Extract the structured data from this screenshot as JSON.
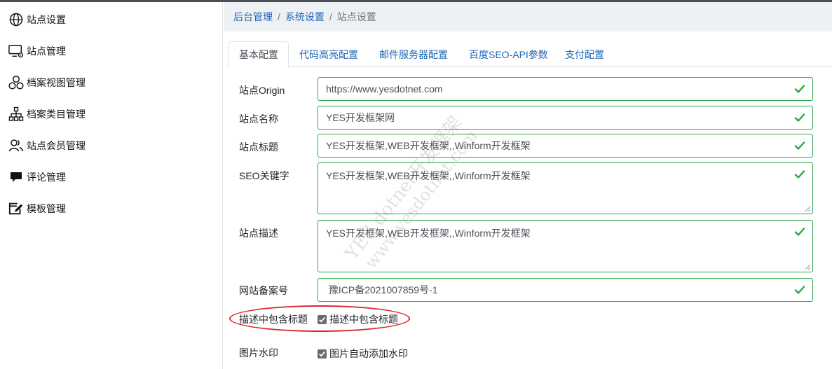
{
  "sidebar": {
    "items": [
      {
        "label": "站点设置",
        "icon": "globe-icon"
      },
      {
        "label": "站点管理",
        "icon": "monitor-gear-icon"
      },
      {
        "label": "档案视图管理",
        "icon": "circles-icon"
      },
      {
        "label": "档案类目管理",
        "icon": "sitemap-icon"
      },
      {
        "label": "站点会员管理",
        "icon": "users-icon"
      },
      {
        "label": "评论管理",
        "icon": "comment-icon"
      },
      {
        "label": "模板管理",
        "icon": "template-edit-icon"
      }
    ]
  },
  "breadcrumb": {
    "items": [
      "后台管理",
      "系统设置"
    ],
    "separator": "/",
    "current": "站点设置"
  },
  "tabs": [
    {
      "label": "基本配置",
      "active": true
    },
    {
      "label": "代码高亮配置"
    },
    {
      "label": "邮件服务器配置"
    },
    {
      "label": "百度SEO-API参数"
    },
    {
      "label": "支付配置"
    }
  ],
  "form": {
    "origin": {
      "label": "站点Origin",
      "value": "https://www.yesdotnet.com"
    },
    "name": {
      "label": "站点名称",
      "value": "YES开发框架网"
    },
    "title": {
      "label": "站点标题",
      "value": "YES开发框架,WEB开发框架,,Winform开发框架"
    },
    "keywords": {
      "label": "SEO关键字",
      "value": "YES开发框架,WEB开发框架,,Winform开发框架"
    },
    "description": {
      "label": "站点描述",
      "value": "YES开发框架,WEB开发框架,,Winform开发框架"
    },
    "icp": {
      "label": "网站备案号",
      "value": " 豫ICP备2021007859号-1"
    },
    "desc_include_title": {
      "label": "描述中包含标题",
      "checkbox_label": "描述中包含标题",
      "checked": true
    },
    "watermark": {
      "label": "图片水印",
      "checkbox_label": "图片自动添加水印",
      "checked": true
    }
  },
  "watermark_text": {
    "line1": "YES dotnet开发框架",
    "line2": "www.yesdotnet.com"
  },
  "colors": {
    "valid": "#28a745",
    "link": "#1f65b8",
    "annotation": "#d9262c"
  }
}
